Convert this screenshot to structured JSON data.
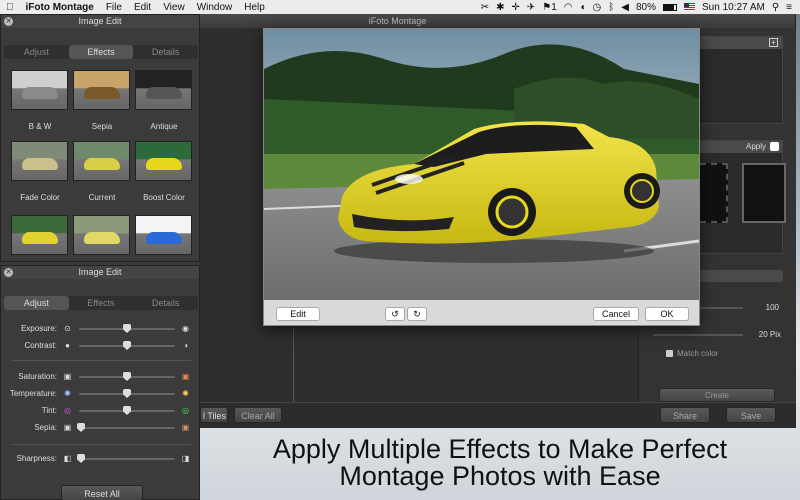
{
  "menubar": {
    "app_name": "iFoto Montage",
    "items": [
      "File",
      "Edit",
      "View",
      "Window",
      "Help"
    ],
    "status": {
      "notification_count": "1",
      "battery": "80%",
      "clock": "Sun 10:27 AM"
    }
  },
  "main_window": {
    "title": "iFoto Montage"
  },
  "effects_panel": {
    "title": "Image Edit",
    "tabs": [
      "Adjust",
      "Effects",
      "Details"
    ],
    "active_tab": "Effects",
    "effects": [
      "B & W",
      "Sepia",
      "Antique",
      "Fade Color",
      "Current",
      "Boost Color"
    ]
  },
  "adjust_panel": {
    "title": "Image Edit",
    "tabs": [
      "Adjust",
      "Effects",
      "Details"
    ],
    "active_tab": "Adjust",
    "sliders": [
      {
        "label": "Exposure:",
        "value": 0.5
      },
      {
        "label": "Contrast:",
        "value": 0.5
      },
      {
        "label": "Saturation:",
        "value": 0.5
      },
      {
        "label": "Temperature:",
        "value": 0.5
      },
      {
        "label": "Tint:",
        "value": 0.5
      },
      {
        "label": "Sepia:",
        "value": 0.0
      },
      {
        "label": "Sharpness:",
        "value": 0.0
      }
    ],
    "reset_label": "Reset All"
  },
  "photo_dialog": {
    "edit_label": "Edit",
    "cancel_label": "Cancel",
    "ok_label": "OK"
  },
  "right_panel": {
    "apply_label": "Apply",
    "value_1": "100",
    "value_2": "20 Pix",
    "match_color_label": "Match color",
    "create_label": "Create"
  },
  "bottom_bar": {
    "tiles_label": "l Tiles",
    "clear_all_label": "Clear All",
    "share_label": "Share",
    "save_label": "Save"
  },
  "caption": {
    "line1": "Apply Multiple Effects to Make Perfect",
    "line2": "Montage Photos with Ease"
  },
  "colors": {
    "car_yellow": "#e8d81c",
    "panel_bg": "#3b3b3b",
    "menubar_bg": "#ececec"
  }
}
